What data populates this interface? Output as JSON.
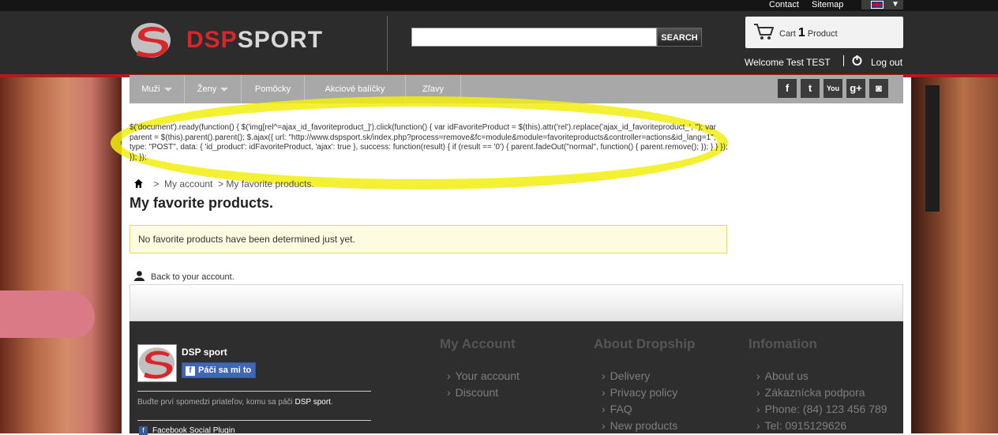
{
  "topbar": {
    "contact": "Contact",
    "sitemap": "Sitemap",
    "language_arrow": "▼"
  },
  "header": {
    "logo_red": "DSP",
    "logo_light": "SPORT",
    "search_button": "SEARCH",
    "search_placeholder": "",
    "cart": {
      "prefix": "Cart",
      "count": "1",
      "suffix": "Product"
    },
    "welcome": "Welcome Test TEST",
    "logout": "Log out"
  },
  "nav": {
    "items": [
      {
        "label": "Muži",
        "has_dropdown": true
      },
      {
        "label": "Ženy",
        "has_dropdown": true
      },
      {
        "label": "Pomôcky",
        "has_dropdown": false
      },
      {
        "label": "Akciové balíčky",
        "has_dropdown": false
      },
      {
        "label": "Zľavy",
        "has_dropdown": false
      }
    ],
    "social": [
      "facebook-icon",
      "twitter-icon",
      "youtube-icon",
      "googleplus-icon",
      "instagram-icon"
    ],
    "social_glyphs": [
      "f",
      "t",
      "You",
      "g+",
      "◙"
    ]
  },
  "js_code": "$('document').ready(function() { $('img[rel^=ajax_id_favoriteproduct_]').click(function() { var idFavoriteProduct = $(this).attr('rel').replace('ajax_id_favoriteproduct_', ''); var parent = $(this).parent().parent(); $.ajax({ url: \"http://www.dspsport.sk/index.php?process=remove&fc=module&module=favoriteproducts&controller=actions&id_lang=1\", type: \"POST\", data: { 'id_product': idFavoriteProduct, 'ajax': true }, success: function(result) { if (result == '0') { parent.fadeOut(\"normal\", function() { parent.remove(); }); } } }); }); });",
  "breadcrumb": {
    "sep1": ">",
    "my_account": "My account",
    "sep2": ">",
    "current": "My favorite products."
  },
  "page_title": "My favorite products.",
  "notice": "No favorite products have been determined just yet.",
  "back_link": "Back to your account.",
  "footer": {
    "facebook": {
      "name": "DSP sport",
      "like_label": "Páči sa mi to",
      "friends_text": "Buďte prví spomedzi priateľov, komu sa páči",
      "friends_page": "DSP sport",
      "friends_end": ".",
      "plugin": "Facebook Social Plugin"
    },
    "columns": [
      {
        "title": "My Account",
        "links": [
          "Your account",
          "Discount"
        ]
      },
      {
        "title": "About Dropship",
        "links": [
          "Delivery",
          "Privacy policy",
          "FAQ",
          "New products"
        ]
      },
      {
        "title": "Infomation",
        "links": [
          "About us",
          "Zákaznícka podpora",
          "Phone: (84) 123 456 789",
          "Tel: 0915129626"
        ]
      }
    ]
  },
  "colors": {
    "brand_red": "#d8262b",
    "header_bg": "#2c2c2c",
    "nav_bg": "#a8a8a8",
    "highlight": "#f2ee10",
    "footer_bg": "#2e2e2e"
  }
}
